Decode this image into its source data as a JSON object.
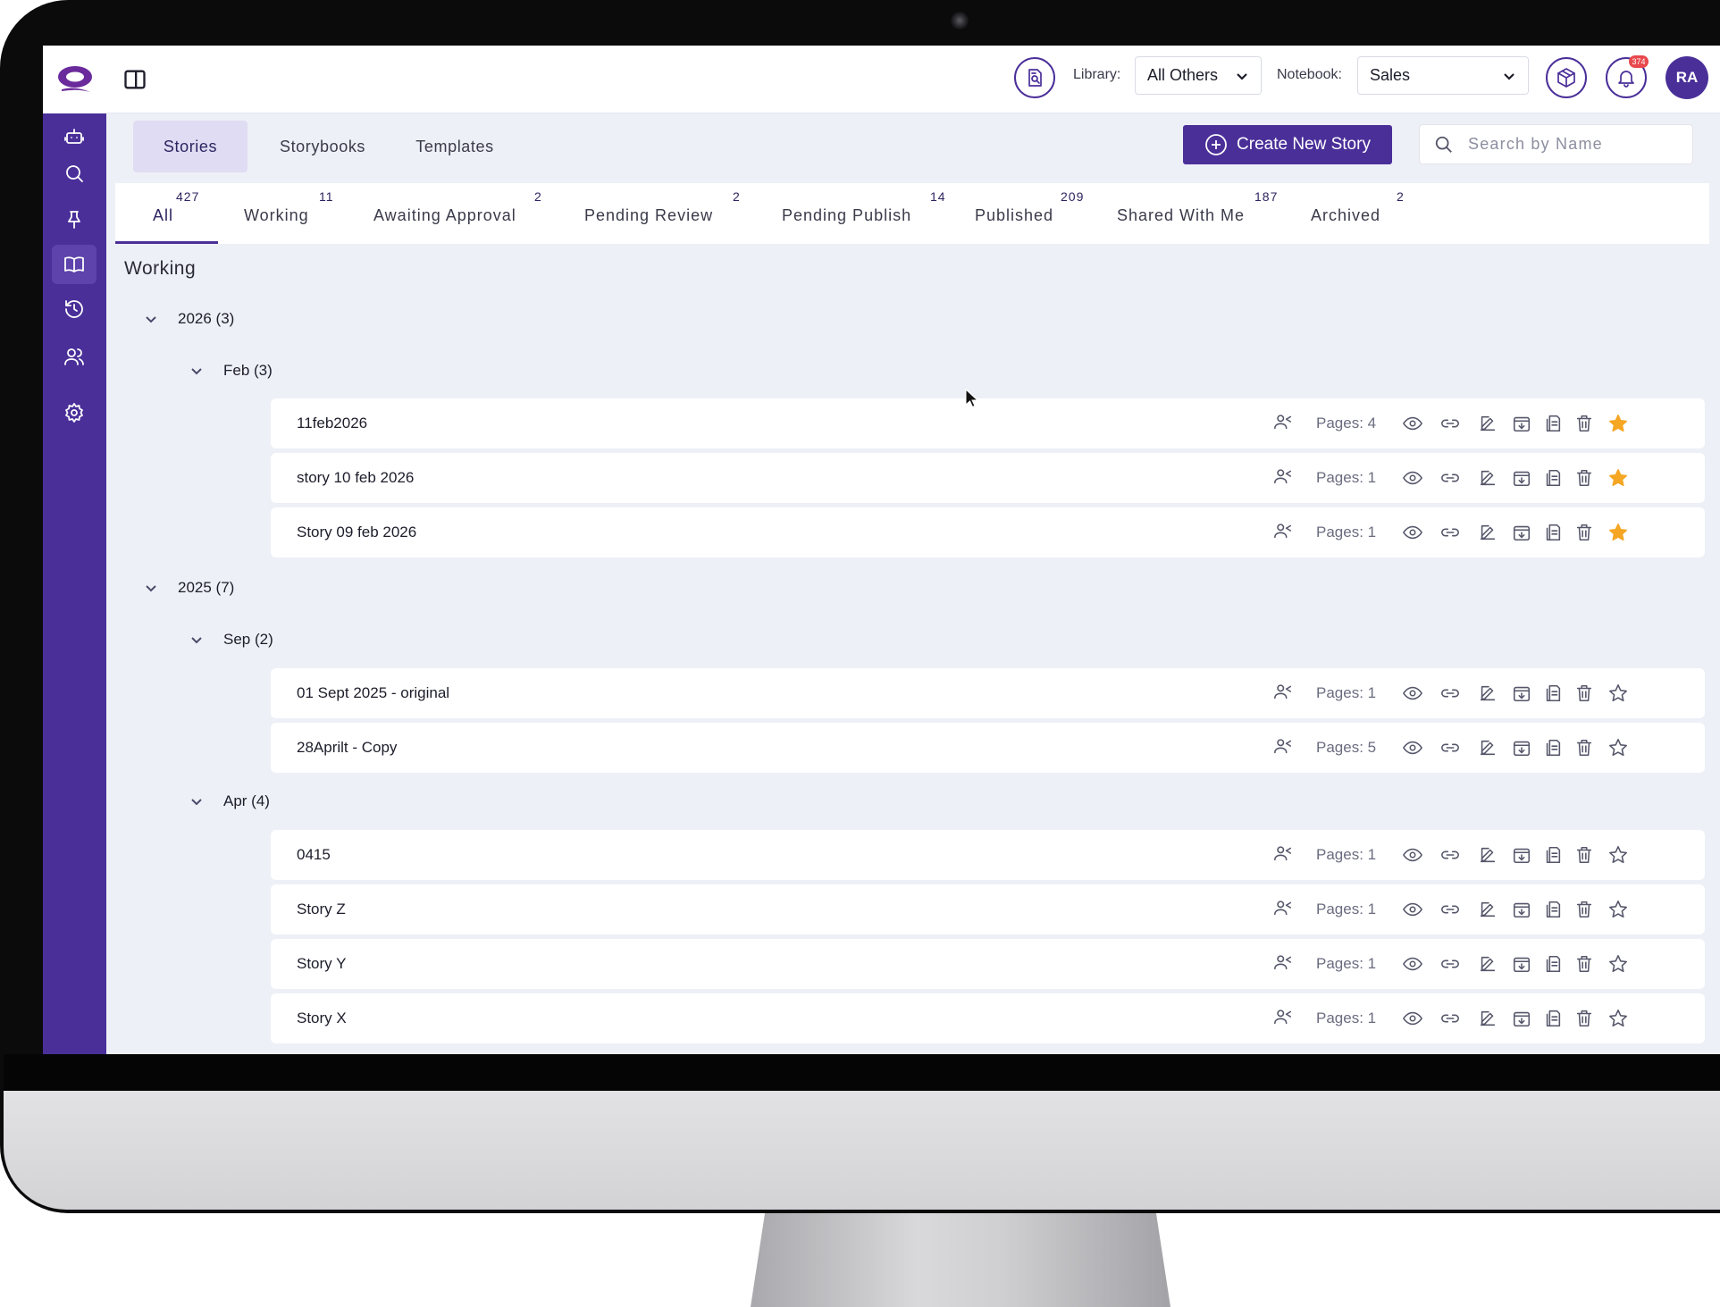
{
  "topbar": {
    "library_label": "Library:",
    "library_value": "All Others",
    "notebook_label": "Notebook:",
    "notebook_value": "Sales",
    "notification_count": "374",
    "avatar_initials": "RA"
  },
  "main_tabs": [
    "Stories",
    "Storybooks",
    "Templates"
  ],
  "create_button": "Create New Story",
  "search_placeholder": "Search by Name",
  "status_tabs": [
    {
      "label": "All",
      "count": "427"
    },
    {
      "label": "Working",
      "count": "11"
    },
    {
      "label": "Awaiting Approval",
      "count": "2"
    },
    {
      "label": "Pending Review",
      "count": "2"
    },
    {
      "label": "Pending Publish",
      "count": "14"
    },
    {
      "label": "Published",
      "count": "209"
    },
    {
      "label": "Shared With Me",
      "count": "187"
    },
    {
      "label": "Archived",
      "count": "2"
    }
  ],
  "section_title": "Working",
  "groups": {
    "y2026": "2026 (3)",
    "feb": "Feb (3)",
    "y2025": "2025 (7)",
    "sep": "Sep (2)",
    "apr": "Apr (4)"
  },
  "stories": [
    {
      "title": "11feb2026",
      "pages": "Pages: 4",
      "starred": true
    },
    {
      "title": "story 10 feb 2026",
      "pages": "Pages: 1",
      "starred": true
    },
    {
      "title": "Story 09 feb 2026",
      "pages": "Pages: 1",
      "starred": true
    },
    {
      "title": "01 Sept 2025 - original",
      "pages": "Pages: 1",
      "starred": false
    },
    {
      "title": "28Aprilt - Copy",
      "pages": "Pages: 5",
      "starred": false
    },
    {
      "title": "0415",
      "pages": "Pages: 1",
      "starred": false
    },
    {
      "title": "Story Z",
      "pages": "Pages: 1",
      "starred": false
    },
    {
      "title": "Story Y",
      "pages": "Pages: 1",
      "starred": false
    },
    {
      "title": "Story X",
      "pages": "Pages: 1",
      "starred": false
    }
  ],
  "icons": {
    "sidebar": [
      "robot-icon",
      "search-icon",
      "pin-icon",
      "book-icon",
      "history-icon",
      "users-icon",
      "gear-icon"
    ],
    "row_actions": [
      "share-users-icon",
      "eye-icon",
      "link-icon",
      "edit-icon",
      "download-icon",
      "copy-icon",
      "trash-icon",
      "star-icon"
    ]
  },
  "colors": {
    "brand": "#4a2f99",
    "star": "#f5a623",
    "badge": "#e8484c"
  }
}
